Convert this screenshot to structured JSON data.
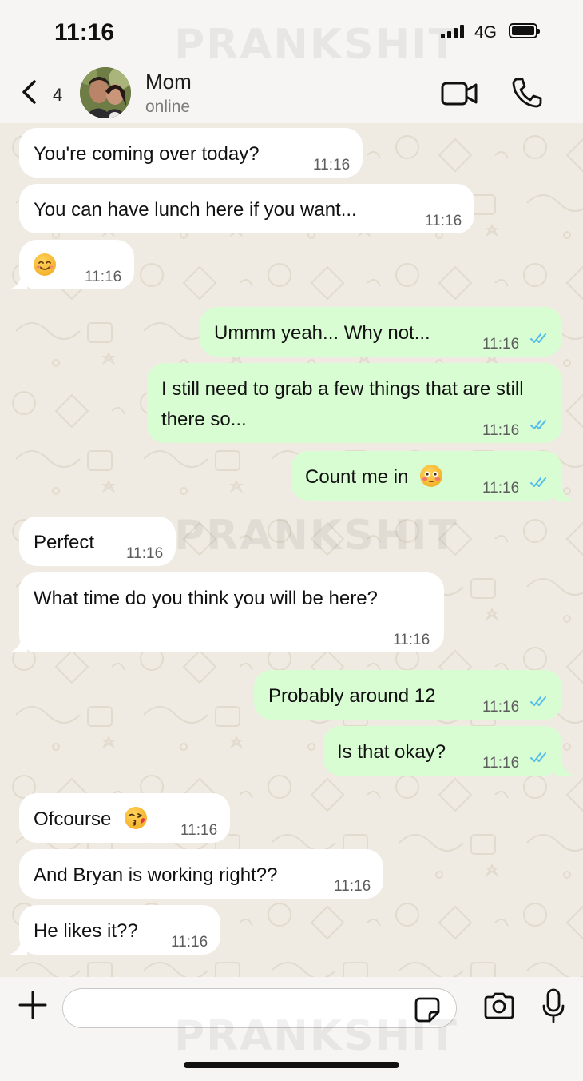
{
  "status_bar": {
    "time": "11:16",
    "network": "4G"
  },
  "watermark": "PRANKSHIT",
  "header": {
    "back_count": "4",
    "contact_name": "Mom",
    "contact_status": "online"
  },
  "messages": [
    {
      "dir": "in",
      "text": "You're coming over today?",
      "time": "11:16"
    },
    {
      "dir": "in",
      "text": "You can have lunch here if you want...",
      "time": "11:16"
    },
    {
      "dir": "in",
      "text": "",
      "emoji": "smiling-face-emoji",
      "time": "11:16"
    },
    {
      "dir": "out",
      "text": "Ummm yeah... Why not...",
      "time": "11:16",
      "read": true
    },
    {
      "dir": "out",
      "text": "I still need to grab a few things that are still there so...",
      "time": "11:16",
      "read": true
    },
    {
      "dir": "out",
      "text": "Count me in",
      "emoji": "flushed-face-emoji",
      "time": "11:16",
      "read": true
    },
    {
      "dir": "in",
      "text": "Perfect",
      "time": "11:16"
    },
    {
      "dir": "in",
      "text": "What time do you think you will be here?",
      "time": "11:16"
    },
    {
      "dir": "out",
      "text": "Probably around 12",
      "time": "11:16",
      "read": true
    },
    {
      "dir": "out",
      "text": "Is that okay?",
      "time": "11:16",
      "read": true
    },
    {
      "dir": "in",
      "text": "Ofcourse",
      "emoji": "kissing-face-emoji",
      "time": "11:16"
    },
    {
      "dir": "in",
      "text": "And Bryan is working right??",
      "time": "11:16"
    },
    {
      "dir": "in",
      "text": "He likes it??",
      "time": "11:16"
    }
  ],
  "input": {
    "value": "",
    "placeholder": ""
  },
  "colors": {
    "incoming": "#ffffff",
    "outgoing": "#d9fdd3",
    "read_ticks": "#53bdeb",
    "chat_bg": "#efeae2"
  }
}
